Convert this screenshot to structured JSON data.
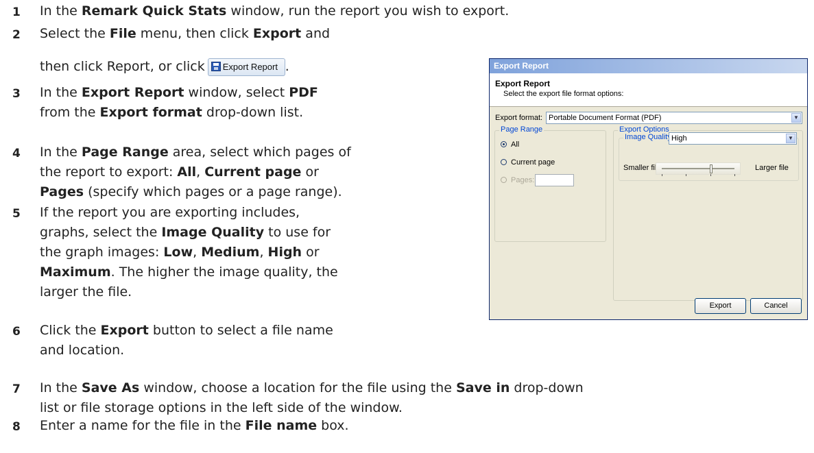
{
  "steps": [
    {
      "num": "1",
      "parts": [
        [
          "t",
          "In the "
        ],
        [
          "b",
          "Remark Quick Stats"
        ],
        [
          "t",
          " window, run the report you wish to export."
        ]
      ]
    },
    {
      "num": "2",
      "line1": [
        [
          "t",
          "Select the "
        ],
        [
          "b",
          "File"
        ],
        [
          "t",
          " menu, then click "
        ],
        [
          "b",
          "Export"
        ],
        [
          "t",
          " and"
        ]
      ],
      "line2": "then click Report, or click",
      "line2_end": "."
    },
    {
      "num": "3",
      "line1": [
        [
          "t",
          "In the "
        ],
        [
          "b",
          "Export Report"
        ],
        [
          "t",
          " window, select "
        ],
        [
          "b",
          "PDF"
        ]
      ],
      "line2": [
        [
          "t",
          "from the "
        ],
        [
          "b",
          "Export format"
        ],
        [
          "t",
          " drop-down list."
        ]
      ]
    },
    {
      "num": "4",
      "line1": [
        [
          "t",
          "In the "
        ],
        [
          "b",
          "Page Range"
        ],
        [
          "t",
          " area, select which pages of"
        ]
      ],
      "line2": [
        [
          "t",
          "the report to export: "
        ],
        [
          "b",
          "All"
        ],
        [
          "t",
          ", "
        ],
        [
          "b",
          "Current page"
        ],
        [
          "t",
          " or"
        ]
      ],
      "line3": [
        [
          "b",
          "Pages"
        ],
        [
          "t",
          " (specify which pages or a page range)."
        ]
      ]
    },
    {
      "num": "5",
      "line1": [
        [
          "t",
          "If the report you are exporting includes,"
        ]
      ],
      "line2": [
        [
          "t",
          "graphs, select the "
        ],
        [
          "b",
          "Image Quality"
        ],
        [
          "t",
          " to use for"
        ]
      ],
      "line3": [
        [
          "t",
          "the graph images: "
        ],
        [
          "b",
          "Low"
        ],
        [
          "t",
          ", "
        ],
        [
          "b",
          "Medium"
        ],
        [
          "t",
          ", "
        ],
        [
          "b",
          "High"
        ],
        [
          "t",
          " or"
        ]
      ],
      "line4": [
        [
          "b",
          "Maximum"
        ],
        [
          "t",
          ". The higher the image quality, the"
        ]
      ],
      "line5": [
        [
          "t",
          "larger the file."
        ]
      ]
    },
    {
      "num": "6",
      "line1": [
        [
          "t",
          "Click the "
        ],
        [
          "b",
          "Export"
        ],
        [
          "t",
          " button to select a file name"
        ]
      ],
      "line2": [
        [
          "t",
          "and location."
        ]
      ]
    },
    {
      "num": "7",
      "line1": [
        [
          "t",
          "In the "
        ],
        [
          "b",
          "Save As"
        ],
        [
          "t",
          " window, choose a location for the file using the "
        ],
        [
          "b",
          "Save in"
        ],
        [
          "t",
          " drop-down"
        ]
      ],
      "line2": [
        [
          "t",
          "list or file storage options in the left side of the window."
        ]
      ]
    },
    {
      "num": "8",
      "line1": [
        [
          "t",
          "Enter a name for the file in the "
        ],
        [
          "b",
          "File name"
        ],
        [
          "t",
          " box."
        ]
      ]
    }
  ],
  "toolbar_button": {
    "label": "Export Report",
    "icon": "save-disk-icon"
  },
  "dialog": {
    "window_title": "Export Report",
    "header_title": "Export Report",
    "header_subtitle": "Select the export file format options:",
    "format_label": "Export format:",
    "format_value": "Portable Document Format (PDF)",
    "page_range": {
      "label": "Page Range",
      "options": [
        "All",
        "Current page",
        "Pages:"
      ],
      "selected": "All"
    },
    "export_options": {
      "label": "Export Options",
      "image_quality_label": "Image Quality:",
      "image_quality_value": "High",
      "smaller_label": "Smaller file",
      "larger_label": "Larger file",
      "slider_level": 0.67
    },
    "buttons": {
      "export": "Export",
      "cancel": "Cancel"
    },
    "colors": {
      "title_bar": "#7fa2db",
      "face": "#ece9d8",
      "group_label": "#0046d5"
    }
  }
}
